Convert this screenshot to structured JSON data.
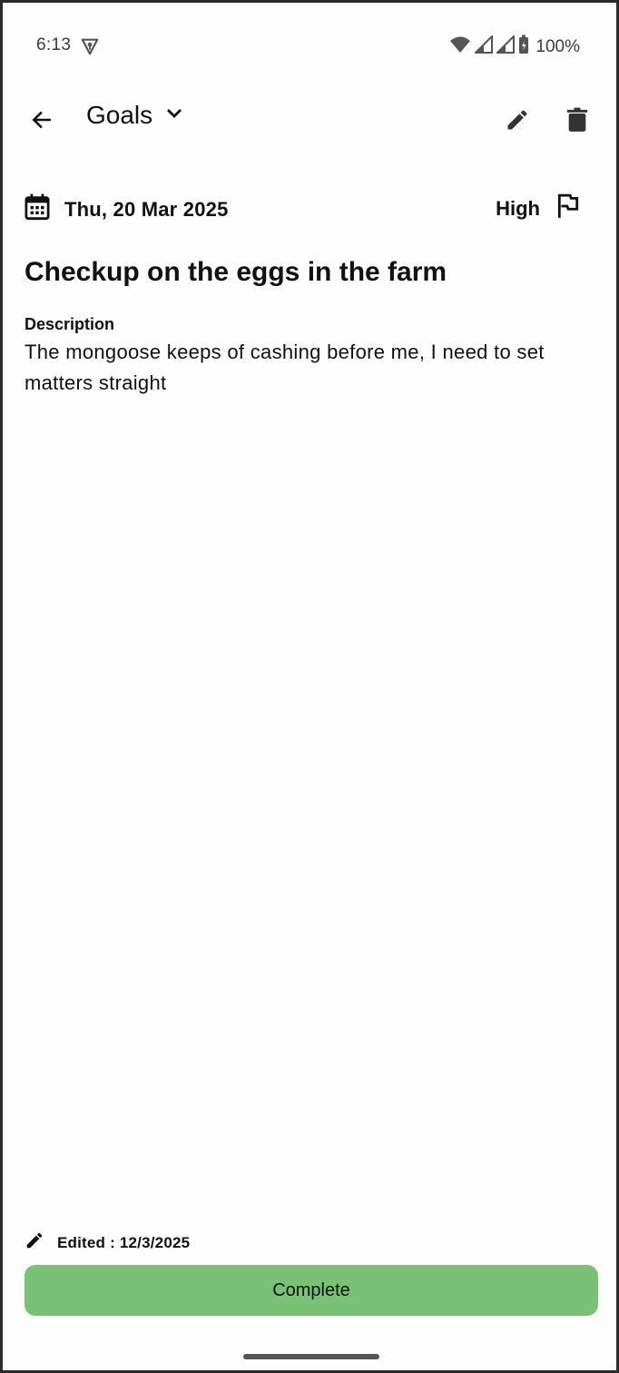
{
  "status_bar": {
    "time": "6:13",
    "battery": "100%"
  },
  "app_bar": {
    "category": "Goals"
  },
  "task": {
    "date": "Thu, 20 Mar 2025",
    "priority": "High",
    "title": "Checkup on the eggs in the farm",
    "description_label": "Description",
    "description": "The mongoose keeps of cashing before me, I need to set matters straight"
  },
  "footer": {
    "edited": "Edited : 12/3/2025",
    "complete_label": "Complete"
  },
  "colors": {
    "complete_button": "#79c174",
    "background": "#fdfdfd"
  },
  "icons": [
    "vpn-key-icon",
    "wifi-icon",
    "signal-icon",
    "battery-icon",
    "back-arrow-icon",
    "chevron-down-icon",
    "pencil-icon",
    "trash-icon",
    "calendar-icon",
    "flag-icon"
  ]
}
